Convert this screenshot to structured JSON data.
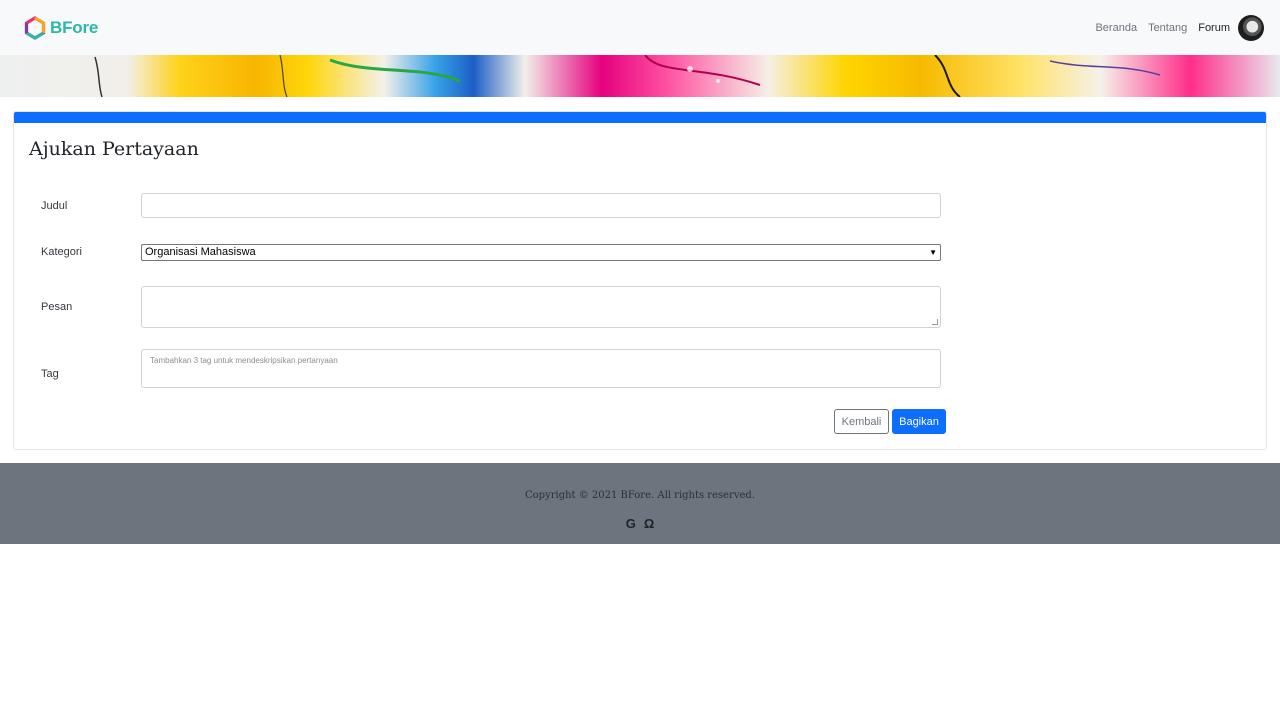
{
  "navbar": {
    "brand": "BFore",
    "links": [
      "Beranda",
      "Tentang",
      "Forum"
    ],
    "active_link": "Forum"
  },
  "form": {
    "title": "Ajukan Pertayaan",
    "labels": {
      "title": "Judul",
      "category": "Kategori",
      "message": "Pesan",
      "tag": "Tag"
    },
    "title_value": "",
    "category_value": "Organisasi Mahasiswa",
    "message_value": "",
    "tag_placeholder": "Tambahkan 3 tag untuk mendeskripsikan pertanyaan",
    "back_label": "Kembali",
    "share_label": "Bagikan"
  },
  "footer": {
    "copyright": "Copyright © 2021 BFore. All rights reserved.",
    "social_icons": [
      "google-icon",
      "omega-icon"
    ]
  },
  "colors": {
    "primary": "#0d6efd",
    "brand": "#2bb7a9",
    "footer": "#6c757d"
  }
}
